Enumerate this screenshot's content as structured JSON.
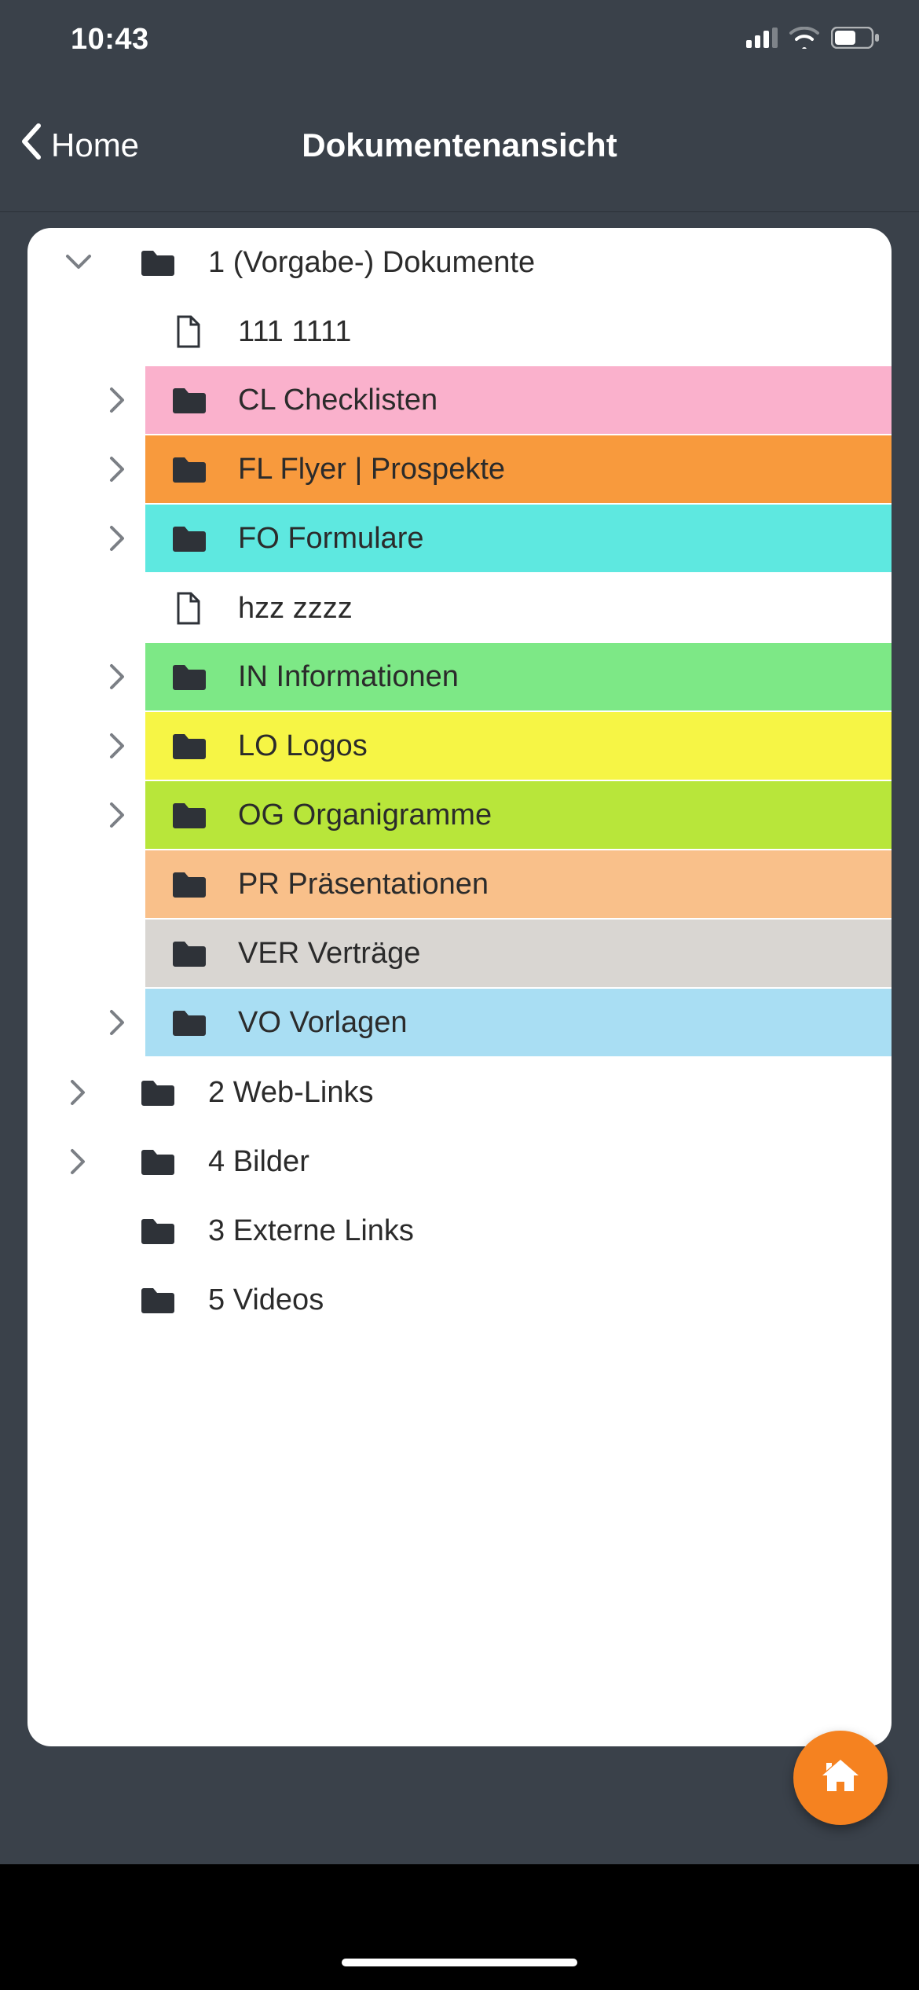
{
  "status": {
    "time": "10:43"
  },
  "nav": {
    "back_label": "Home",
    "title": "Dokumentenansicht"
  },
  "colors": {
    "pink": "#fab1cc",
    "orange": "#f89a3d",
    "cyan": "#5ee8e0",
    "green": "#7de886",
    "yellow": "#f6f545",
    "lime": "#b8e63a",
    "peach": "#f9c08a",
    "grey": "#d9d6d2",
    "lightblue": "#a9def3",
    "fab": "#f58220"
  },
  "tree": [
    {
      "level": 0,
      "kind": "folder",
      "disclosure": "open",
      "label": "1 (Vorgabe-) Dokumente",
      "colorKey": null
    },
    {
      "level": 1,
      "kind": "file",
      "disclosure": "none",
      "label": "111 1111",
      "colorKey": null
    },
    {
      "level": 1,
      "kind": "folder",
      "disclosure": "closed",
      "label": "CL Checklisten",
      "colorKey": "pink"
    },
    {
      "level": 1,
      "kind": "folder",
      "disclosure": "closed",
      "label": "FL Flyer | Prospekte",
      "colorKey": "orange"
    },
    {
      "level": 1,
      "kind": "folder",
      "disclosure": "closed",
      "label": "FO Formulare",
      "colorKey": "cyan"
    },
    {
      "level": 1,
      "kind": "file",
      "disclosure": "none",
      "label": "hzz zzzz",
      "colorKey": null
    },
    {
      "level": 1,
      "kind": "folder",
      "disclosure": "closed",
      "label": "IN Informationen",
      "colorKey": "green"
    },
    {
      "level": 1,
      "kind": "folder",
      "disclosure": "closed",
      "label": "LO Logos",
      "colorKey": "yellow"
    },
    {
      "level": 1,
      "kind": "folder",
      "disclosure": "closed",
      "label": "OG Organigramme",
      "colorKey": "lime"
    },
    {
      "level": 1,
      "kind": "folder",
      "disclosure": "none",
      "label": "PR Präsentationen",
      "colorKey": "peach"
    },
    {
      "level": 1,
      "kind": "folder",
      "disclosure": "none",
      "label": "VER Verträge",
      "colorKey": "grey"
    },
    {
      "level": 1,
      "kind": "folder",
      "disclosure": "closed",
      "label": "VO Vorlagen",
      "colorKey": "lightblue"
    },
    {
      "level": 0,
      "kind": "folder",
      "disclosure": "closed",
      "label": "2 Web-Links",
      "colorKey": null
    },
    {
      "level": 0,
      "kind": "folder",
      "disclosure": "closed",
      "label": "4 Bilder",
      "colorKey": null
    },
    {
      "level": 0,
      "kind": "folder",
      "disclosure": "none",
      "label": "3 Externe Links",
      "colorKey": null
    },
    {
      "level": 0,
      "kind": "folder",
      "disclosure": "none",
      "label": "5 Videos",
      "colorKey": null
    }
  ]
}
